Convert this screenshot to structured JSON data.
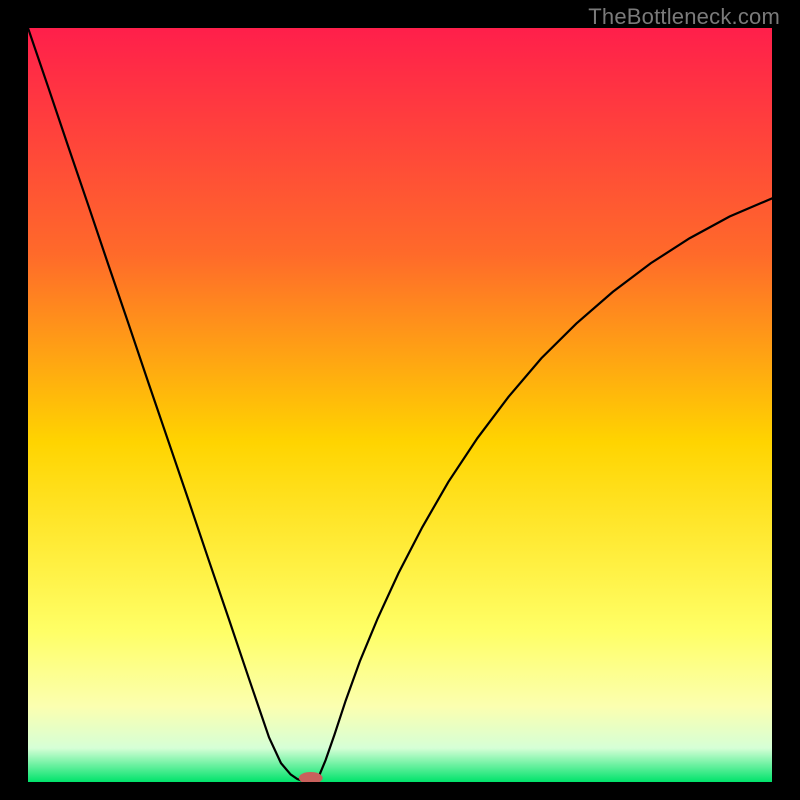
{
  "watermark": "TheBottleneck.com",
  "chart_data": {
    "type": "line",
    "title": "",
    "xlabel": "",
    "ylabel": "",
    "xlim": [
      0,
      100
    ],
    "ylim": [
      0,
      100
    ],
    "background_gradient": {
      "stops": [
        {
          "offset": 0.0,
          "color": "#ff1f4b"
        },
        {
          "offset": 0.3,
          "color": "#ff6a2a"
        },
        {
          "offset": 0.55,
          "color": "#ffd400"
        },
        {
          "offset": 0.8,
          "color": "#ffff66"
        },
        {
          "offset": 0.9,
          "color": "#fbffb0"
        },
        {
          "offset": 0.955,
          "color": "#d6ffd6"
        },
        {
          "offset": 1.0,
          "color": "#00e36b"
        }
      ]
    },
    "series": [
      {
        "name": "left-branch",
        "x": [
          0.0,
          2.7,
          5.4,
          8.1,
          10.8,
          13.5,
          16.2,
          18.9,
          21.6,
          24.3,
          27.0,
          29.7,
          32.4,
          34.0,
          35.3,
          36.2,
          36.9,
          37.4
        ],
        "y": [
          100.0,
          92.2,
          84.3,
          76.5,
          68.6,
          60.8,
          52.9,
          45.1,
          37.3,
          29.4,
          21.6,
          13.7,
          5.9,
          2.5,
          1.0,
          0.4,
          0.15,
          0.0
        ]
      },
      {
        "name": "right-branch",
        "x": [
          38.6,
          39.2,
          40.0,
          41.2,
          42.7,
          44.6,
          47.0,
          49.8,
          53.0,
          56.5,
          60.4,
          64.6,
          69.0,
          73.7,
          78.6,
          83.7,
          88.9,
          94.3,
          100.0
        ],
        "y": [
          0.0,
          1.0,
          2.9,
          6.3,
          10.8,
          16.0,
          21.7,
          27.7,
          33.8,
          39.8,
          45.6,
          51.1,
          56.2,
          60.8,
          65.0,
          68.8,
          72.1,
          75.0,
          77.4
        ]
      }
    ],
    "marker": {
      "name": "bottleneck-marker",
      "x": 38.0,
      "y": 0.0,
      "rx": 1.6,
      "ry": 0.8,
      "color": "#c9605c"
    },
    "frame_color": "#000000",
    "curve_stroke": "#000000",
    "curve_width": 2.2
  }
}
